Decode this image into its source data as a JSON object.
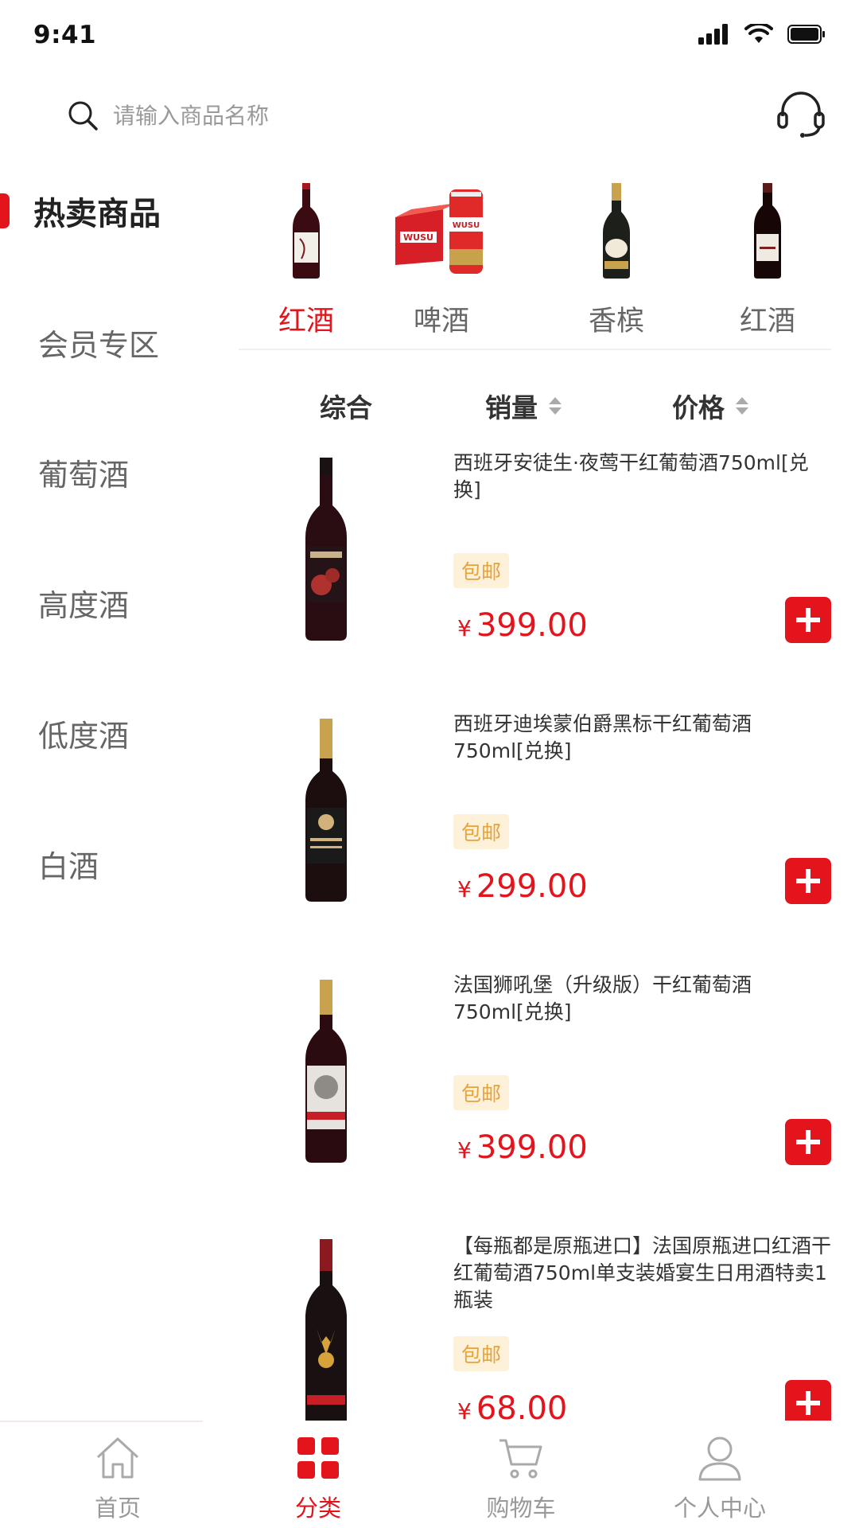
{
  "status_bar": {
    "time": "9:41"
  },
  "search": {
    "placeholder": "请输入商品名称"
  },
  "colors": {
    "accent": "#e3141b",
    "badge_bg": "#fdf2d9",
    "badge_text": "#e6a23c",
    "muted": "#999999"
  },
  "sidebar": {
    "items": [
      {
        "label": "热卖商品",
        "active": true
      },
      {
        "label": "会员专区"
      },
      {
        "label": "葡萄酒"
      },
      {
        "label": "高度酒"
      },
      {
        "label": "低度酒"
      },
      {
        "label": "白酒"
      }
    ]
  },
  "categories": [
    {
      "label": "红酒",
      "active": true,
      "icon": "red-wine-bottle-icon"
    },
    {
      "label": "啤酒",
      "icon": "beer-pack-icon"
    },
    {
      "label": "香槟",
      "icon": "champagne-bottle-icon"
    },
    {
      "label": "红酒",
      "icon": "red-wine-bottle-icon"
    }
  ],
  "sort": {
    "general": "综合",
    "sales": "销量",
    "price": "价格"
  },
  "products": [
    {
      "title": "西班牙安徒生·夜莺干红葡萄酒750ml[兑换]",
      "badge": "包邮",
      "currency": "¥",
      "price": "399.00"
    },
    {
      "title": "西班牙迪埃蒙伯爵黑标干红葡萄酒750ml[兑换]",
      "badge": "包邮",
      "currency": "¥",
      "price": "299.00"
    },
    {
      "title": "法国狮吼堡（升级版）干红葡萄酒750ml[兑换]",
      "badge": "包邮",
      "currency": "¥",
      "price": "399.00"
    },
    {
      "title": "【每瓶都是原瓶进口】法国原瓶进口红酒干红葡萄酒750ml单支装婚宴生日用酒特卖1瓶装",
      "badge": "包邮",
      "currency": "¥",
      "price": "68.00"
    }
  ],
  "tabbar": [
    {
      "label": "首页",
      "icon": "home-icon"
    },
    {
      "label": "分类",
      "icon": "category-grid-icon",
      "active": true
    },
    {
      "label": "购物车",
      "icon": "cart-icon"
    },
    {
      "label": "个人中心",
      "icon": "user-icon"
    }
  ]
}
